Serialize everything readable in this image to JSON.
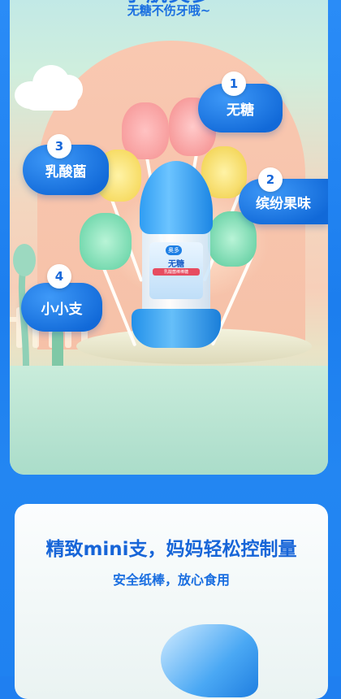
{
  "hero": {
    "title": "小航奥多",
    "subtitle": "无糖不伤牙哦~"
  },
  "features": [
    {
      "number": "1",
      "label": "无糖"
    },
    {
      "number": "2",
      "label": "缤纷果味"
    },
    {
      "number": "3",
      "label": "乳酸菌"
    },
    {
      "number": "4",
      "label": "小小支"
    }
  ],
  "product": {
    "brand": "奥多",
    "name": "无糖",
    "tagline": "乳酸菌棒棒糖"
  },
  "section2": {
    "title": "精致mini支，妈妈轻松控制量",
    "subtitle": "安全纸棒，放心食用"
  },
  "colors": {
    "primary": "#1b6fe0",
    "background": "#1f7ff0"
  }
}
